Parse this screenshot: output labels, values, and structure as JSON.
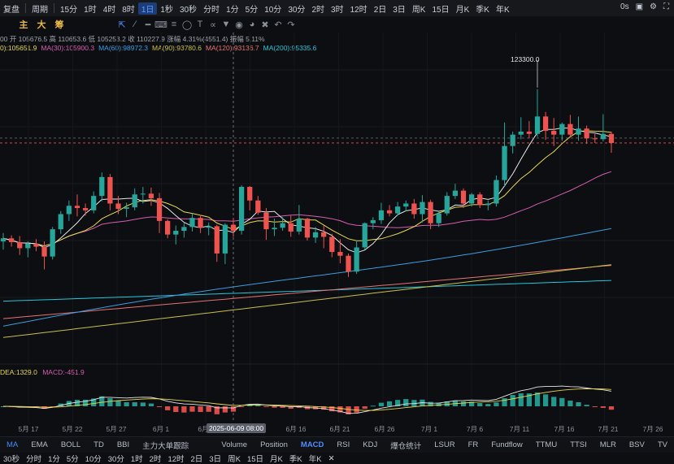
{
  "toolbar": {
    "items": [
      "复盘",
      "周期",
      "15分",
      "1时",
      "4时",
      "8时",
      "1日",
      "1秒",
      "30秒",
      "分时",
      "1分",
      "5分",
      "10分",
      "30分",
      "2时",
      "3时",
      "12时",
      "2日",
      "3日",
      "周K",
      "15日",
      "月K",
      "季K",
      "年K"
    ],
    "active": "1日",
    "right": [
      "0s"
    ]
  },
  "subbar": {
    "buttons": [
      "主",
      "大",
      "筹"
    ]
  },
  "info": {
    "ohlc": "00  开 105676.5  高 110653.6  低 105253.2  收 110227.9  涨幅 4.31%(4551.4)  振幅 5.11%",
    "ma": [
      {
        "label": "0):105651.9",
        "color": "#e8d94a"
      },
      {
        "label": "MA(30):105900.3",
        "color": "#d65db1"
      },
      {
        "label": "MA(60):98972.3",
        "color": "#3a9ee0"
      },
      {
        "label": "MA(90):93780.6",
        "color": "#c9c04a"
      },
      {
        "label": "MA(120):93136.7",
        "color": "#e57373"
      },
      {
        "label": "MA(200):95335.6",
        "color": "#26c6da"
      }
    ]
  },
  "high_label": "123300.0",
  "macd": {
    "dea": "DEA:1329.0",
    "macd": "MACD:-451.9"
  },
  "dates": [
    "5月 17",
    "5月 22",
    "5月 27",
    "6月 1",
    "6月",
    "6月 16",
    "6月 21",
    "6月 26",
    "7月 1",
    "7月 6",
    "7月 11",
    "7月 16",
    "7月 21",
    "7月 26"
  ],
  "crosshair_date": "2025-06-09 08:00",
  "indicators": {
    "main": [
      "MA",
      "EMA",
      "BOLL",
      "TD",
      "BBI",
      "主力大单跟踪"
    ],
    "sub": [
      "Volume",
      "Position",
      "MACD",
      "RSI",
      "KDJ",
      "爆仓统计",
      "LSUR",
      "FR",
      "Fundflow",
      "TTMU",
      "TTSI",
      "MLR",
      "BSV",
      "TV"
    ],
    "main_active": "MA",
    "sub_active": "MACD"
  },
  "bottom": [
    "30秒",
    "分时",
    "1分",
    "5分",
    "10分",
    "30分",
    "1时",
    "2时",
    "12时",
    "2日",
    "3日",
    "周K",
    "15日",
    "月K",
    "季K",
    "年K"
  ],
  "colors": {
    "up": "#26a69a",
    "down": "#ef5350",
    "bg": "#0d0e11"
  },
  "chart_data": {
    "type": "candlestick",
    "ohlc": [
      [
        103200,
        104300,
        102100,
        103600
      ],
      [
        103600,
        104000,
        102500,
        103100
      ],
      [
        103100,
        103900,
        101400,
        102300
      ],
      [
        102300,
        103200,
        101100,
        102900
      ],
      [
        102900,
        103500,
        101900,
        102500
      ],
      [
        102500,
        103200,
        99500,
        101200
      ],
      [
        101200,
        105100,
        100800,
        104800
      ],
      [
        104800,
        107200,
        104200,
        106800
      ],
      [
        106800,
        108600,
        105900,
        107900
      ],
      [
        107900,
        109400,
        106500,
        107600
      ],
      [
        107600,
        108200,
        106600,
        107300
      ],
      [
        107300,
        109800,
        106900,
        109200
      ],
      [
        109200,
        112300,
        108500,
        111700
      ],
      [
        111700,
        112100,
        107300,
        108200
      ],
      [
        108200,
        109200,
        106800,
        107500
      ],
      [
        107500,
        108300,
        106400,
        107700
      ],
      [
        107700,
        110200,
        107300,
        109400
      ],
      [
        109400,
        110400,
        108200,
        109500
      ],
      [
        109500,
        110300,
        107900,
        108900
      ],
      [
        108900,
        109600,
        104300,
        105900
      ],
      [
        105900,
        106100,
        103600,
        104100
      ],
      [
        104100,
        105300,
        102800,
        104600
      ],
      [
        104600,
        105700,
        103700,
        105100
      ],
      [
        105100,
        106900,
        104500,
        106300
      ],
      [
        106300,
        106700,
        104300,
        105000
      ],
      [
        105000,
        105700,
        104000,
        105200
      ],
      [
        105200,
        105400,
        100500,
        101600
      ],
      [
        101600,
        105600,
        100200,
        105400
      ],
      [
        105400,
        106300,
        103800,
        104600
      ],
      [
        104600,
        110600,
        104100,
        110400
      ],
      [
        110400,
        110500,
        107300,
        108600
      ],
      [
        108600,
        109200,
        106700,
        107000
      ],
      [
        107000,
        107600,
        103400,
        104800
      ],
      [
        104800,
        106200,
        103900,
        105000
      ],
      [
        105000,
        106400,
        104600,
        105600
      ],
      [
        105600,
        106600,
        103800,
        104500
      ],
      [
        104500,
        108000,
        104100,
        106200
      ],
      [
        106200,
        106300,
        103300,
        103700
      ],
      [
        103700,
        105100,
        103000,
        104400
      ],
      [
        104400,
        105300,
        102300,
        103800
      ],
      [
        103800,
        104200,
        101100,
        101800
      ],
      [
        101800,
        103500,
        100300,
        101300
      ],
      [
        101300,
        101600,
        98500,
        99200
      ],
      [
        99200,
        103300,
        98900,
        102400
      ],
      [
        102400,
        105700,
        102100,
        105600
      ],
      [
        105600,
        106400,
        104800,
        106000
      ],
      [
        106000,
        108300,
        105500,
        107300
      ],
      [
        107300,
        108000,
        106500,
        106900
      ],
      [
        106900,
        108400,
        106600,
        107800
      ],
      [
        107800,
        108600,
        107200,
        108200
      ],
      [
        108200,
        108800,
        106200,
        106800
      ],
      [
        106800,
        109300,
        105700,
        108400
      ],
      [
        108400,
        108700,
        104800,
        105600
      ],
      [
        105600,
        107300,
        105100,
        106900
      ],
      [
        106900,
        109700,
        106600,
        109200
      ],
      [
        109200,
        110800,
        108800,
        109900
      ],
      [
        109900,
        110200,
        107600,
        108200
      ],
      [
        108200,
        109600,
        107800,
        109400
      ],
      [
        109400,
        109700,
        107600,
        108000
      ],
      [
        108000,
        108600,
        107300,
        108200
      ],
      [
        108200,
        111900,
        107800,
        111300
      ],
      [
        111300,
        118900,
        110500,
        115800
      ],
      [
        115800,
        117700,
        114800,
        117300
      ],
      [
        117300,
        119600,
        116700,
        117700
      ],
      [
        117700,
        119100,
        116800,
        117400
      ],
      [
        117400,
        123300,
        117000,
        119700
      ],
      [
        119700,
        120300,
        116600,
        117800
      ],
      [
        117800,
        119500,
        115800,
        117300
      ],
      [
        117300,
        118900,
        116500,
        118700
      ],
      [
        118700,
        119900,
        116900,
        117300
      ],
      [
        117300,
        119700,
        116500,
        118100
      ],
      [
        118100,
        118500,
        116100,
        116800
      ],
      [
        116800,
        117400,
        116200,
        116700
      ],
      [
        116700,
        120000,
        116400,
        117400
      ],
      [
        117400,
        117700,
        114900,
        116200
      ]
    ],
    "ylim": [
      90000,
      128000
    ],
    "macd_ylim": [
      -4000,
      4000
    ]
  }
}
